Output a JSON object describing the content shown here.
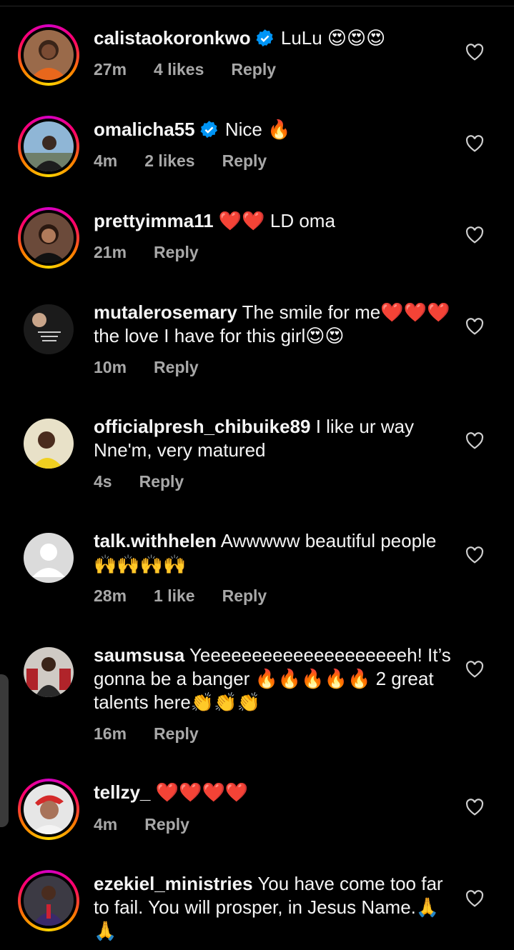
{
  "comments": [
    {
      "username": "calistaokoronkwo",
      "verified": true,
      "text": "LuLu 😍😍😍",
      "time": "27m",
      "likes": "4 likes",
      "reply": "Reply",
      "ring": true,
      "avatar": "woman-orange"
    },
    {
      "username": "omalicha55",
      "verified": true,
      "text": "Nice 🔥",
      "time": "4m",
      "likes": "2 likes",
      "reply": "Reply",
      "ring": true,
      "avatar": "man-sky"
    },
    {
      "username": "prettyimma11",
      "verified": false,
      "text": "❤️❤️ LD oma",
      "time": "21m",
      "likes": "",
      "reply": "Reply",
      "ring": true,
      "avatar": "woman-dark"
    },
    {
      "username": "mutalerosemary",
      "verified": false,
      "text": "The smile for me❤️❤️❤️the love I have for this girl😍😍",
      "time": "10m",
      "likes": "",
      "reply": "Reply",
      "ring": false,
      "avatar": "collage"
    },
    {
      "username": "officialpresh_chibuike89",
      "verified": false,
      "text": "I like ur way Nne'm, very matured",
      "time": "4s",
      "likes": "",
      "reply": "Reply",
      "ring": false,
      "avatar": "woman-yellow"
    },
    {
      "username": "talk.withhelen",
      "verified": false,
      "text": "Awwwww beautiful people 🙌🙌🙌🙌",
      "time": "28m",
      "likes": "1 like",
      "reply": "Reply",
      "ring": false,
      "avatar": "default"
    },
    {
      "username": "saumsusa",
      "verified": false,
      "text": "Yeeeeeeeeeeeeeeeeeeeeh! It’s gonna be a banger 🔥🔥🔥🔥🔥 2 great talents here👏👏👏",
      "time": "16m",
      "likes": "",
      "reply": "Reply",
      "ring": false,
      "avatar": "woman-red"
    },
    {
      "username": "tellzy_",
      "verified": false,
      "text": "❤️❤️❤️❤️",
      "time": "4m",
      "likes": "",
      "reply": "Reply",
      "ring": true,
      "avatar": "man-cap"
    },
    {
      "username": "ezekiel_ministries",
      "verified": false,
      "text": "You have come too far to fail. You will prosper, in Jesus Name.🙏🙏",
      "time": "",
      "likes": "",
      "reply": "",
      "ring": true,
      "avatar": "man-suit"
    }
  ],
  "colors": {
    "background": "#000000",
    "meta": "#a8a8a8",
    "verified": "#0095f6",
    "text": "#f5f5f5"
  },
  "icons": {
    "verified": "verified-badge-icon",
    "like": "heart-outline-icon"
  }
}
